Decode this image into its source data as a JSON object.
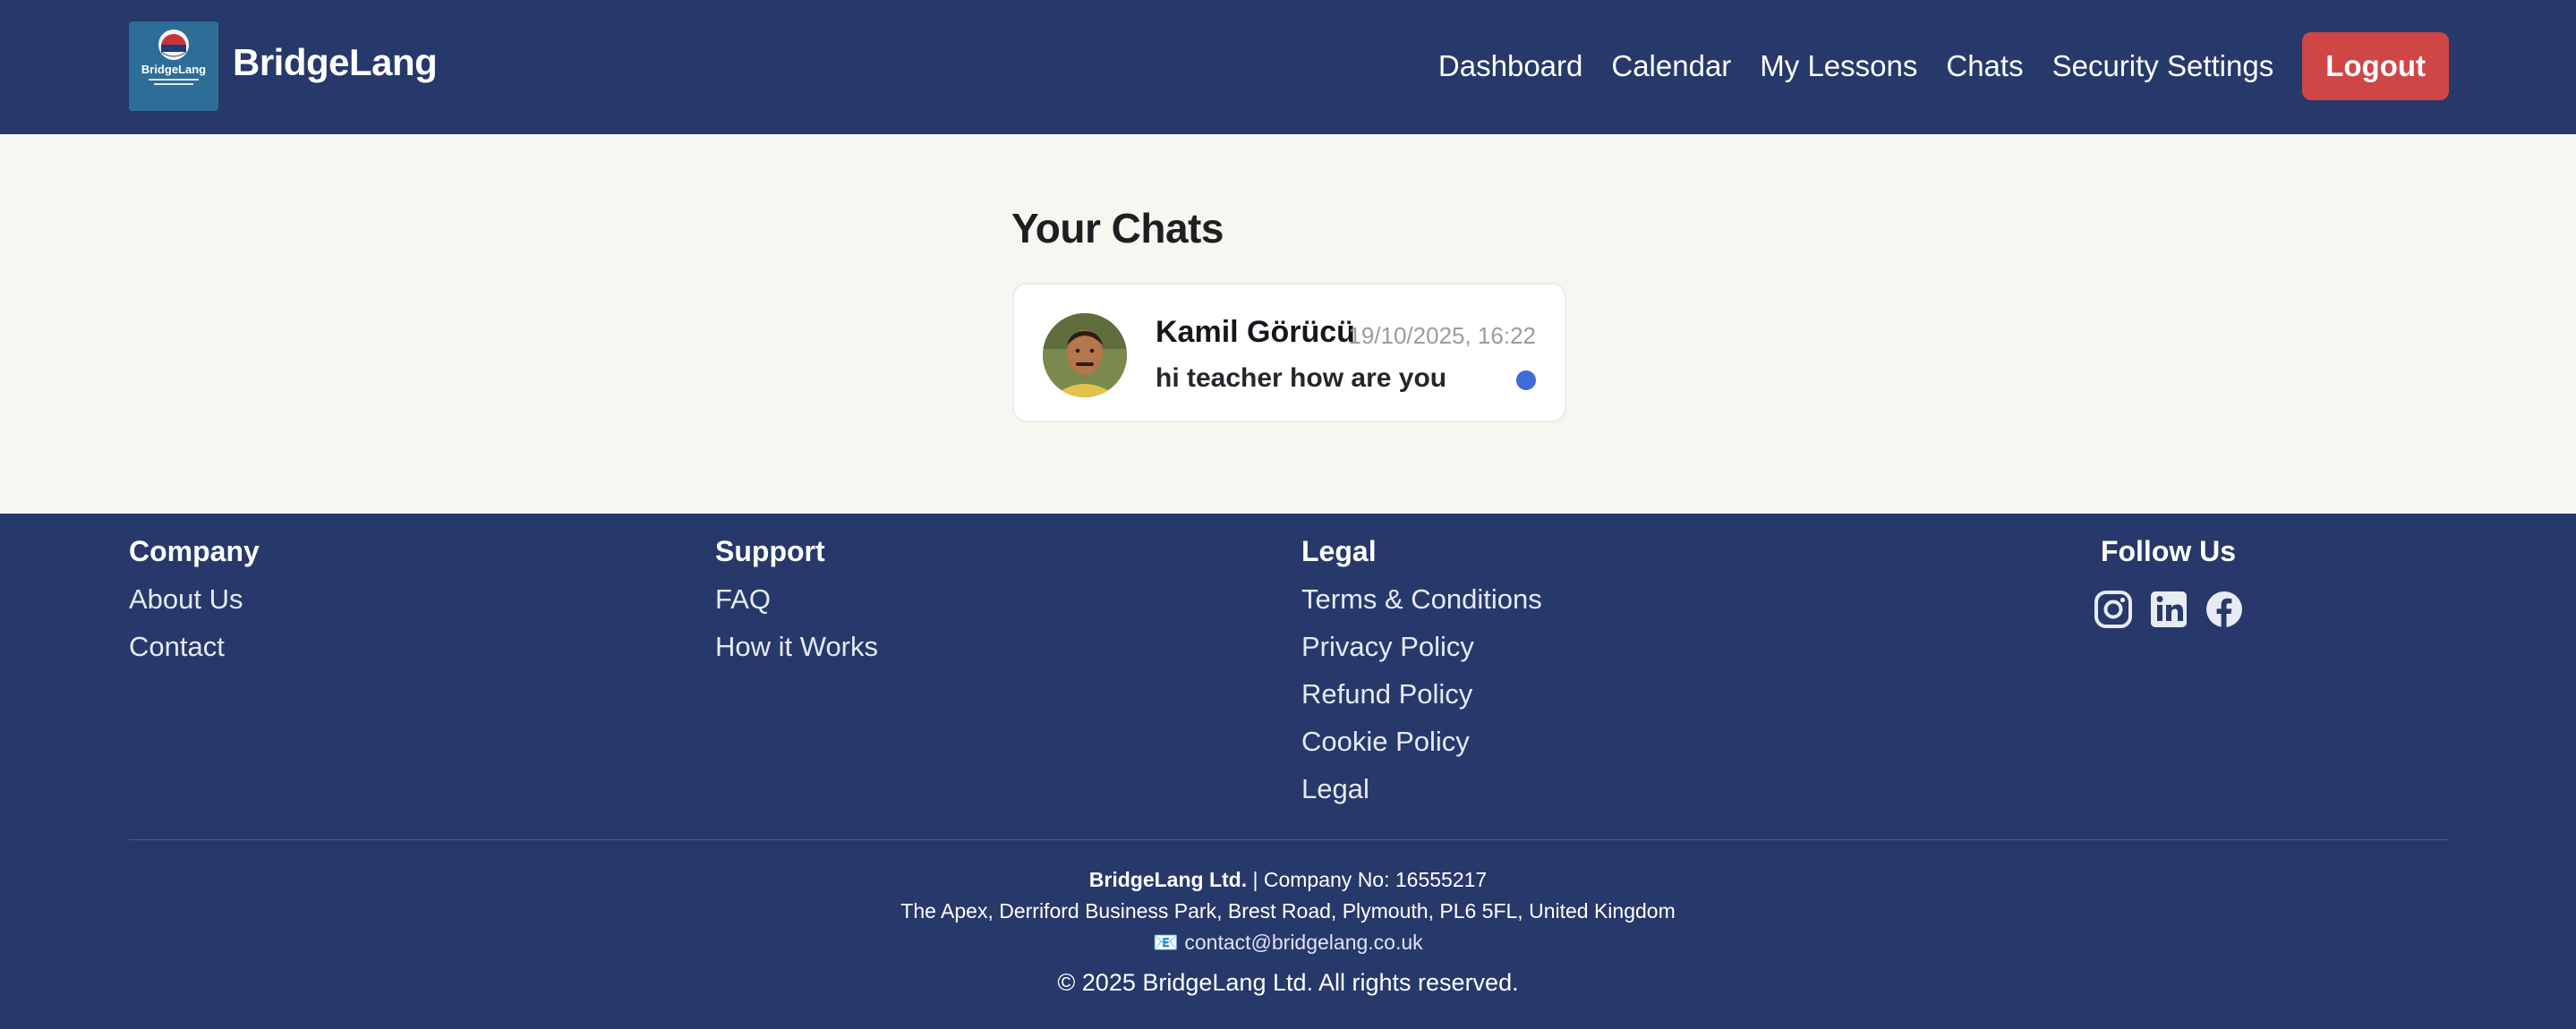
{
  "header": {
    "brand": "BridgeLang",
    "logo_text": "BridgeLang",
    "nav": [
      "Dashboard",
      "Calendar",
      "My Lessons",
      "Chats",
      "Security Settings"
    ],
    "logout_label": "Logout"
  },
  "main": {
    "title": "Your Chats",
    "chats": [
      {
        "name": "Kamil Görücü",
        "timestamp": "19/10/2025, 16:22",
        "last_message": "hi teacher how are you",
        "unread": true
      }
    ]
  },
  "footer": {
    "company": {
      "heading": "Company",
      "links": [
        "About Us",
        "Contact"
      ]
    },
    "support": {
      "heading": "Support",
      "links": [
        "FAQ",
        "How it Works"
      ]
    },
    "legal": {
      "heading": "Legal",
      "links": [
        "Terms & Conditions",
        "Privacy Policy",
        "Refund Policy",
        "Cookie Policy",
        "Legal"
      ]
    },
    "follow": {
      "heading": "Follow Us",
      "icons": [
        "instagram-icon",
        "linkedin-icon",
        "facebook-icon"
      ]
    },
    "company_name": "BridgeLang Ltd.",
    "company_no": "| Company No: 16555217",
    "address": "The Apex, Derriford Business Park, Brest Road, Plymouth, PL6 5FL, United Kingdom",
    "email_icon": "📧",
    "email": "contact@bridgelang.co.uk",
    "copyright": "© 2025 BridgeLang Ltd. All rights reserved."
  },
  "colors": {
    "header_bg": "#27396b",
    "page_bg": "#f7f6f1",
    "logout_bg": "#cf4646",
    "unread_dot": "#3f6ad8"
  }
}
